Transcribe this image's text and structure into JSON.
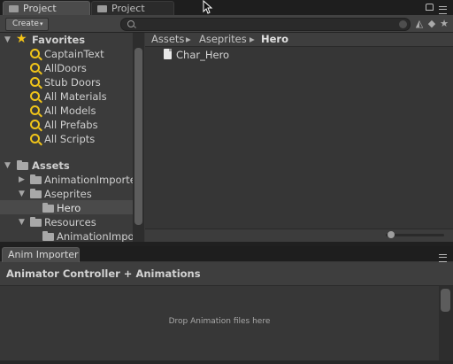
{
  "tabs": {
    "primary": "Project",
    "secondary": "Project"
  },
  "toolbar": {
    "create_label": "Create",
    "create_arrow": "▾",
    "search_placeholder": "",
    "icons": [
      "filter-by-type-icon",
      "filter-by-label-icon",
      "favorite-star-icon"
    ]
  },
  "tree": {
    "favorites_label": "Favorites",
    "favorites": [
      "CaptainText",
      "AllDoors",
      "Stub Doors",
      "All Materials",
      "All Models",
      "All Prefabs",
      "All Scripts"
    ],
    "assets_label": "Assets",
    "assets_children": [
      "AnimationImporter",
      "Aseprites",
      "Hero",
      "Resources",
      "AnimationImpor"
    ],
    "selected": "Hero"
  },
  "breadcrumb": [
    "Assets",
    "Aseprites",
    "Hero"
  ],
  "breadcrumb_sep": "▸",
  "files": [
    "Char_Hero"
  ],
  "bottom_panel": {
    "tab_label": "Anim Importer",
    "header": "Animator Controller + Animations",
    "drop_text": "Drop Animation files here"
  },
  "colors": {
    "favorite_star": "#f5c518",
    "selection": "#4a4a4a",
    "panel_bg": "#383838"
  }
}
